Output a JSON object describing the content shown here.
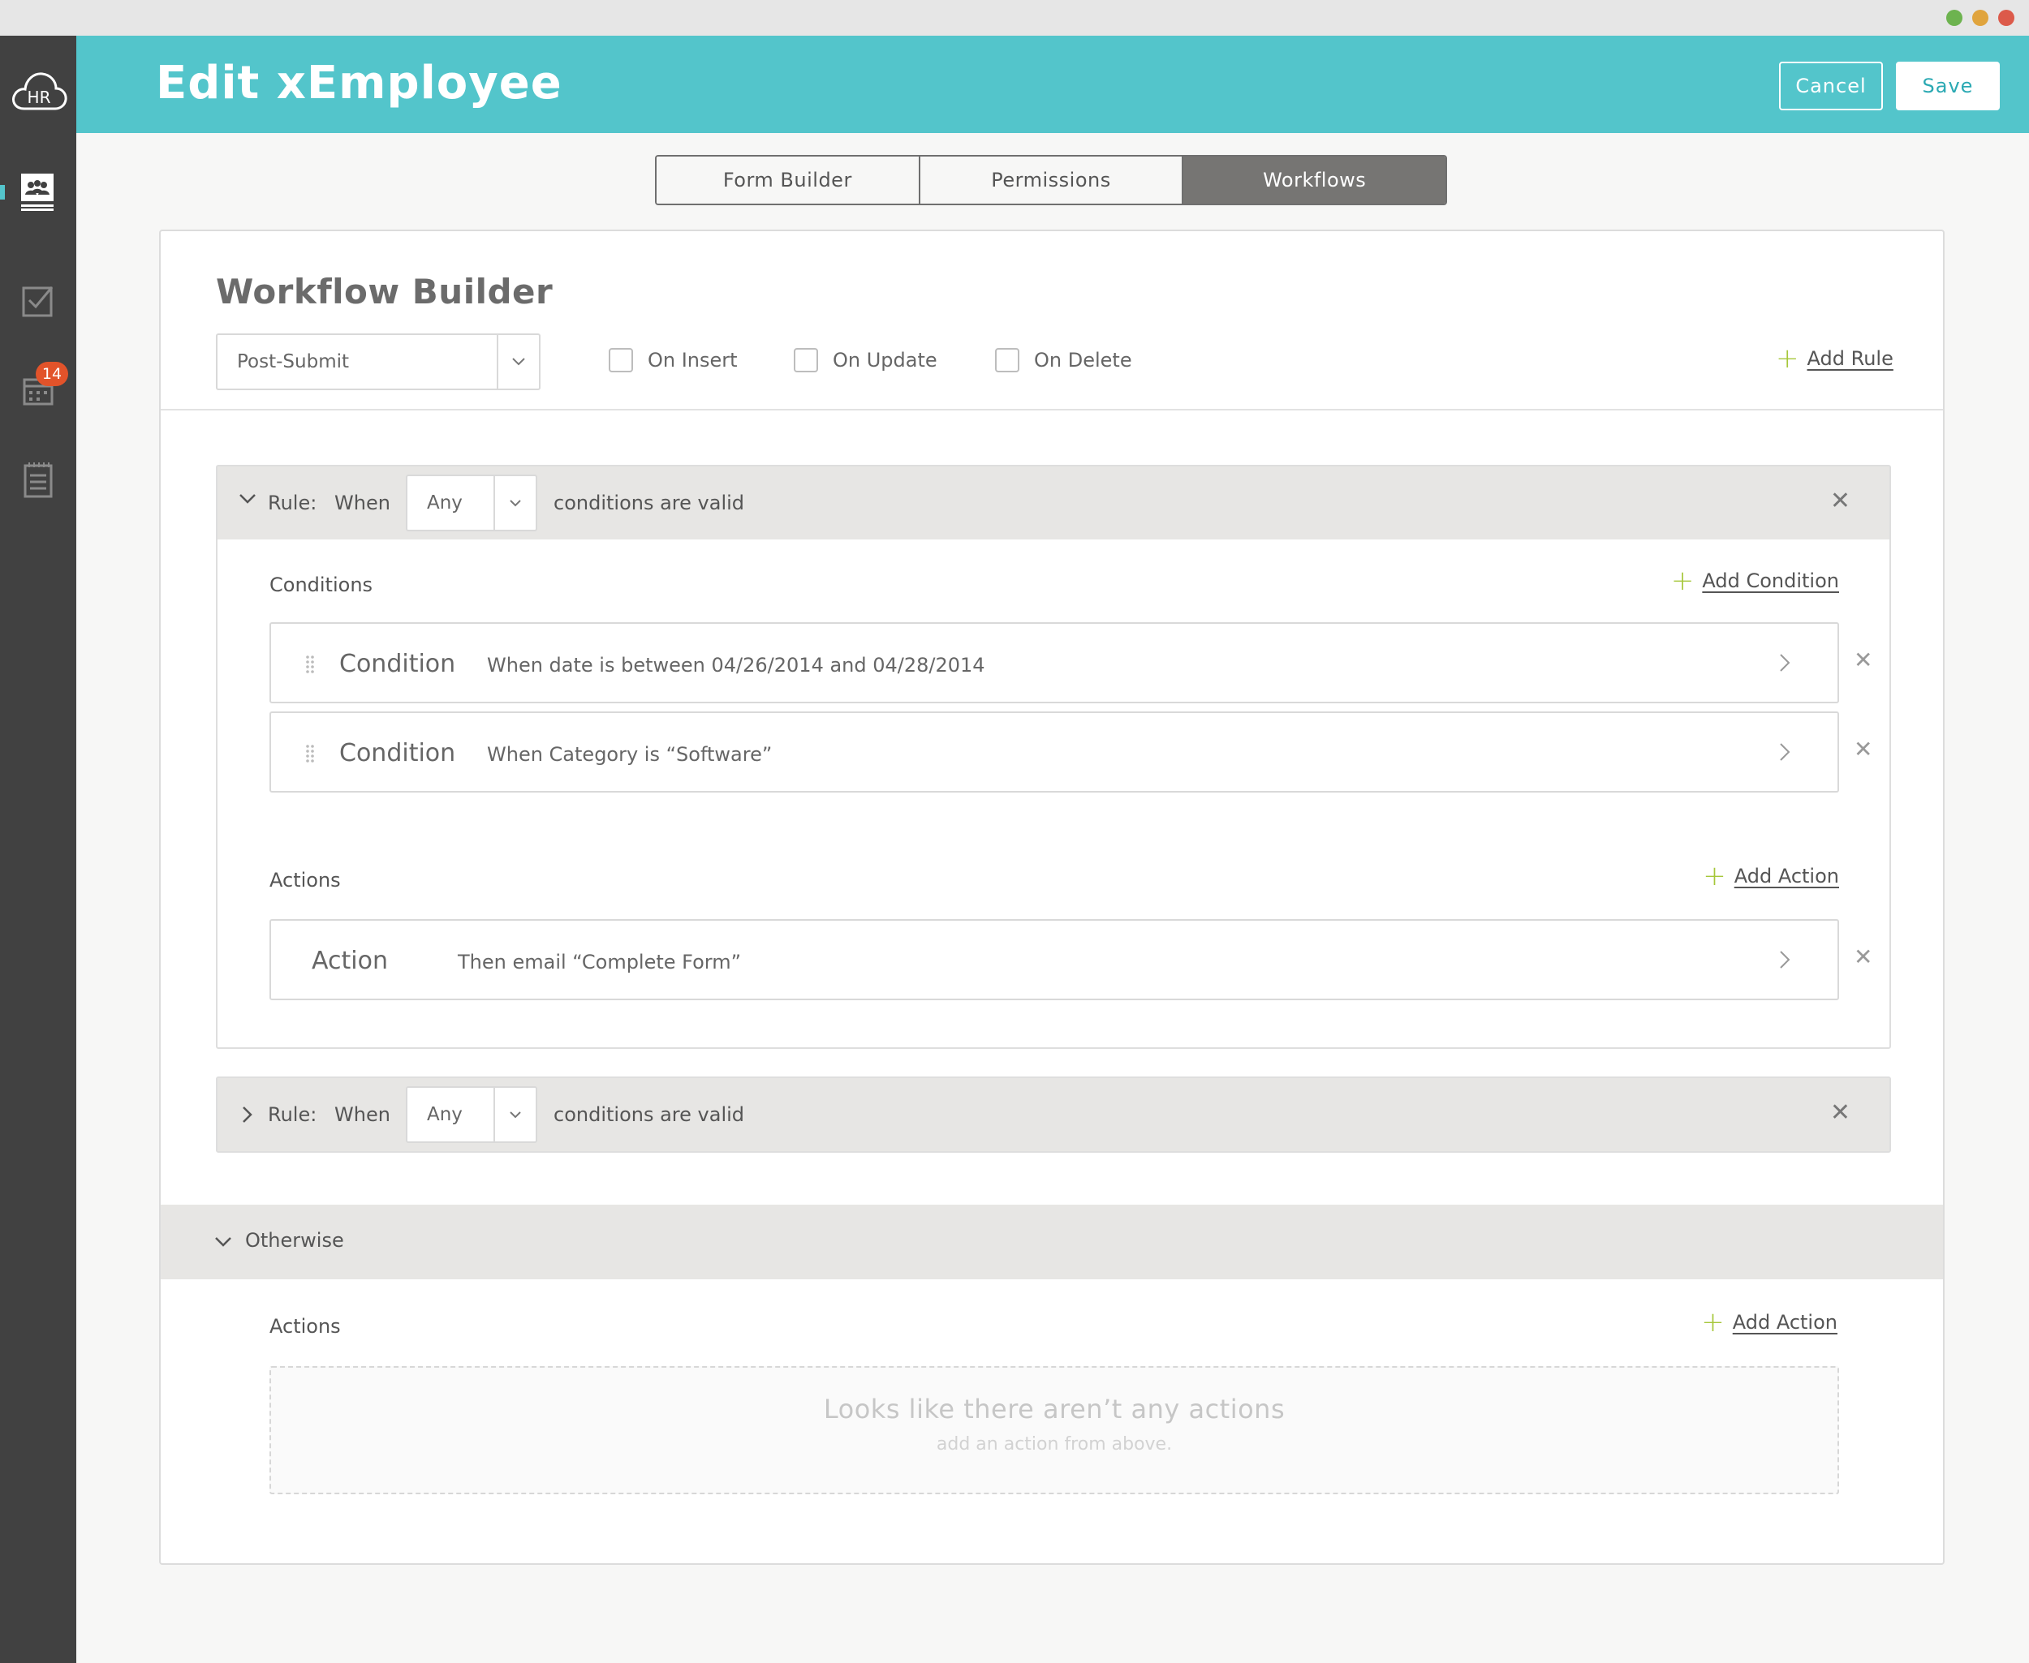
{
  "window": {
    "title": "Edit xEmployee"
  },
  "header": {
    "cancel_label": "Cancel",
    "save_label": "Save"
  },
  "sidebar": {
    "logo_text": "HR",
    "items": [
      {
        "icon": "team-icon",
        "active": true
      },
      {
        "icon": "checkbox-icon",
        "active": false
      },
      {
        "icon": "calendar-icon",
        "active": false,
        "badge": "14"
      },
      {
        "icon": "notepad-icon",
        "active": false
      }
    ]
  },
  "tabs": [
    {
      "label": "Form Builder",
      "active": false
    },
    {
      "label": "Permissions",
      "active": false
    },
    {
      "label": "Workflows",
      "active": true
    }
  ],
  "builder": {
    "title": "Workflow Builder",
    "trigger_select": "Post-Submit",
    "checks": [
      {
        "label": "On Insert",
        "checked": false
      },
      {
        "label": "On Update",
        "checked": false
      },
      {
        "label": "On Delete",
        "checked": false
      }
    ],
    "add_rule": "Add Rule"
  },
  "rules": [
    {
      "expanded": true,
      "rule_label": "Rule:",
      "when_label": "When",
      "match_select": "Any",
      "valid_label": "conditions are valid",
      "conditions_label": "Conditions",
      "add_condition": "Add Condition",
      "conditions": [
        {
          "kind": "Condition",
          "text": "When date is between 04/26/2014 and 04/28/2014"
        },
        {
          "kind": "Condition",
          "text": "When Category is “Software”"
        }
      ],
      "actions_label": "Actions",
      "add_action": "Add Action",
      "actions": [
        {
          "kind": "Action",
          "text": "Then email “Complete Form”"
        }
      ]
    },
    {
      "expanded": false,
      "rule_label": "Rule:",
      "when_label": "When",
      "match_select": "Any",
      "valid_label": "conditions are valid"
    }
  ],
  "otherwise": {
    "label": "Otherwise",
    "actions_label": "Actions",
    "add_action": "Add Action",
    "empty_title": "Looks like there aren’t any actions",
    "empty_sub": "add an action from above."
  },
  "colors": {
    "header": "#53c5cb",
    "sidebar": "#414141",
    "plus_accent": "#a6c73a",
    "badge": "#e2532a",
    "active_tab": "#767573"
  }
}
